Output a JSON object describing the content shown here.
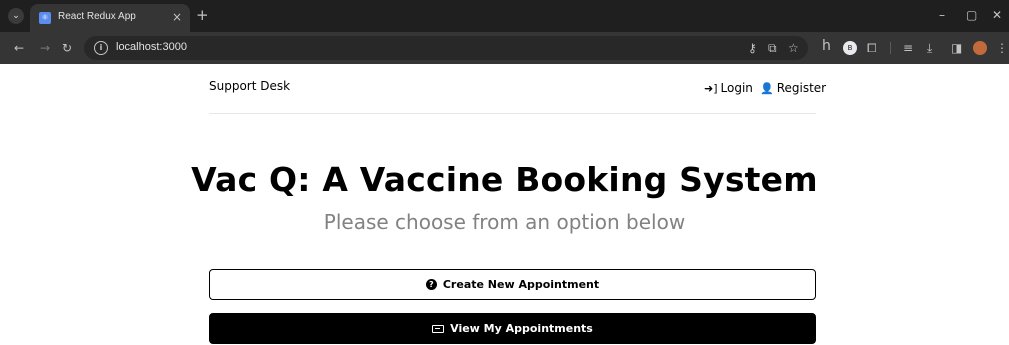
{
  "browser": {
    "tab_title": "React Redux App",
    "tab_close": "×",
    "new_tab": "+",
    "url": "localhost:3000",
    "profile_initial": "B",
    "window_controls": {
      "minimize": "–",
      "restore": "▢",
      "close": "✕"
    },
    "icons": {
      "back": "←",
      "forward": "→",
      "reload": "↻",
      "key": "⚷",
      "cast": "⧉",
      "star": "☆",
      "h": "h",
      "extensions": "⧠",
      "reading_list": "≡",
      "download": "⤓",
      "side_panel": "◨",
      "menu": "⋮"
    }
  },
  "header": {
    "logo": "Support Desk",
    "login_label": "Login",
    "register_label": "Register",
    "login_icon": "sign-in-icon",
    "register_icon": "user-icon"
  },
  "main": {
    "title": "Vac Q: A Vaccine Booking System",
    "subtitle": "Please choose from an option below",
    "create_button": "Create New Appointment",
    "view_button": "View My Appointments",
    "create_icon": "question-circle-icon",
    "view_icon": "ticket-icon"
  }
}
